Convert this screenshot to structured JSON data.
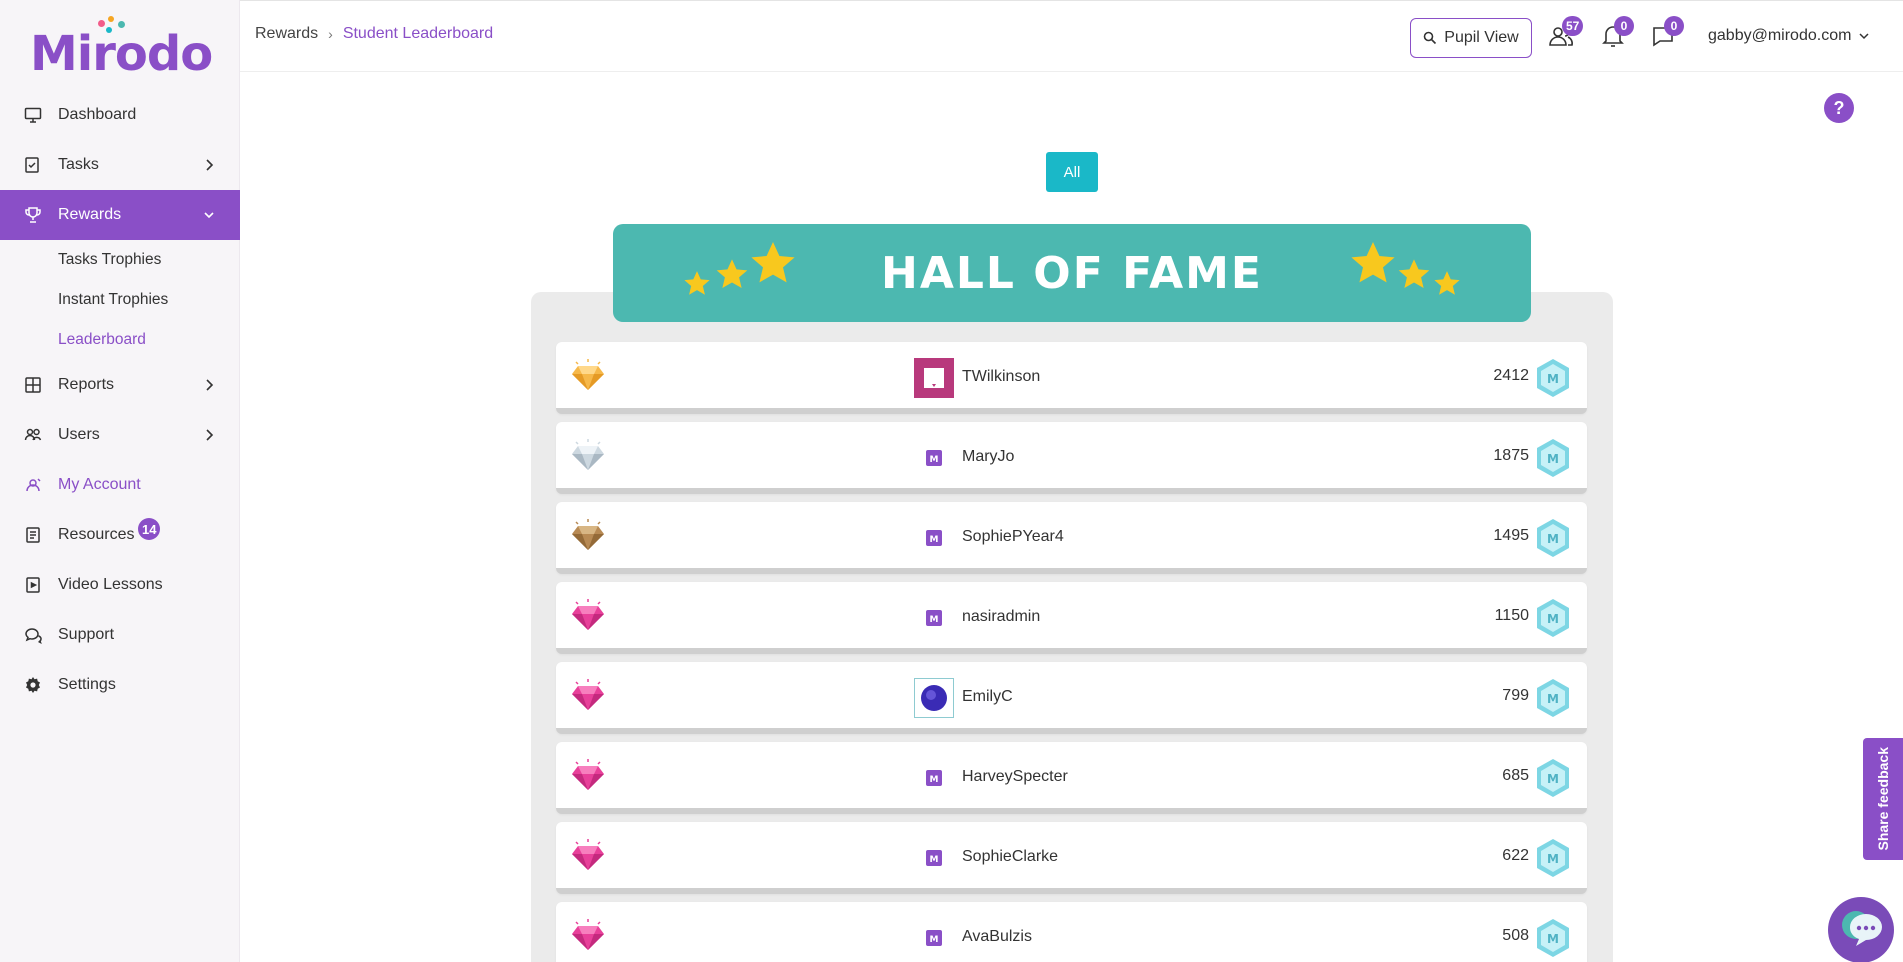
{
  "brand": {
    "logo_text": "Mirodo"
  },
  "sidebar": {
    "items": [
      {
        "label": "Dashboard",
        "icon": "monitor-icon"
      },
      {
        "label": "Tasks",
        "icon": "tasks-icon"
      },
      {
        "label": "Rewards",
        "icon": "trophy-icon"
      },
      {
        "label": "Reports",
        "icon": "reports-icon"
      },
      {
        "label": "Users",
        "icon": "users-icon"
      },
      {
        "label": "My Account",
        "icon": "account-icon"
      },
      {
        "label": "Resources",
        "icon": "resources-icon",
        "badge": "14"
      },
      {
        "label": "Video Lessons",
        "icon": "video-icon"
      },
      {
        "label": "Support",
        "icon": "support-icon"
      },
      {
        "label": "Settings",
        "icon": "gear-icon"
      }
    ],
    "rewards_sub": [
      "Tasks Trophies",
      "Instant Trophies",
      "Leaderboard"
    ]
  },
  "header": {
    "breadcrumb": [
      "Rewards",
      "Student Leaderboard"
    ],
    "pupil_view_label": "Pupil View",
    "users_badge": "57",
    "notifications_badge": "0",
    "messages_badge": "0",
    "user_email": "gabby@mirodo.com"
  },
  "help_label": "?",
  "filter": {
    "all_label": "All"
  },
  "leaderboard": {
    "title": "HALL OF FAME",
    "rows": [
      {
        "name": "TWilkinson",
        "points": "2412",
        "gem": "gold",
        "avatar": "pink-square"
      },
      {
        "name": "MaryJo",
        "points": "1875",
        "gem": "silver",
        "avatar": "m-logo"
      },
      {
        "name": "SophiePYear4",
        "points": "1495",
        "gem": "bronze",
        "avatar": "m-logo"
      },
      {
        "name": "nasiradmin",
        "points": "1150",
        "gem": "pink",
        "avatar": "m-logo"
      },
      {
        "name": "EmilyC",
        "points": "799",
        "gem": "pink",
        "avatar": "blue-circle"
      },
      {
        "name": "HarveySpecter",
        "points": "685",
        "gem": "pink",
        "avatar": "m-logo"
      },
      {
        "name": "SophieClarke",
        "points": "622",
        "gem": "pink",
        "avatar": "m-logo"
      },
      {
        "name": "AvaBulzis",
        "points": "508",
        "gem": "pink",
        "avatar": "m-logo"
      }
    ]
  },
  "feedback_label": "Share feedback",
  "colors": {
    "accent": "#8a4fc7",
    "teal": "#4cb8b0",
    "cyan": "#1ab8c8"
  }
}
